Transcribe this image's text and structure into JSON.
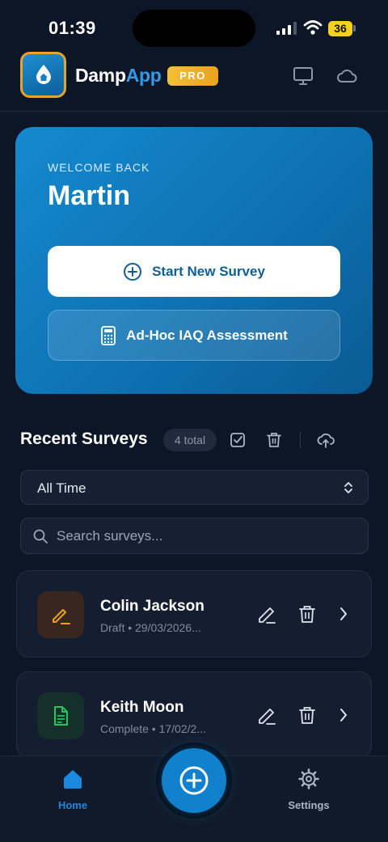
{
  "status_bar": {
    "time": "01:39",
    "battery": "36"
  },
  "header": {
    "brand_part1": "Damp",
    "brand_part2": "App",
    "badge": "PRO",
    "icons": [
      "desktop-icon",
      "cloud-icon"
    ]
  },
  "hero": {
    "greeting": "WELCOME BACK",
    "user_name": "Martin",
    "primary_button": "Start New Survey",
    "secondary_button": "Ad-Hoc IAQ Assessment"
  },
  "recent": {
    "title": "Recent Surveys",
    "count_label": "4 total",
    "tool_icons": [
      "select-all-icon",
      "trash-icon",
      "cloud-upload-icon"
    ],
    "filter": {
      "selected": "All Time"
    },
    "search": {
      "placeholder": "Search surveys..."
    },
    "items": [
      {
        "name": "Colin Jackson",
        "meta": "Draft • 29/03/2026...",
        "status_icon": "pencil-icon",
        "accent": "#e9a21f"
      },
      {
        "name": "Keith Moon",
        "meta": "Complete • 17/02/2...",
        "status_icon": "document-icon",
        "accent": "#22c55e"
      }
    ]
  },
  "bottom_nav": {
    "home_label": "Home",
    "settings_label": "Settings"
  },
  "colors": {
    "background": "#0d1627",
    "accent": "#1181cd",
    "brand_app": "#2f9bea",
    "pro_badge": "#f3c132"
  }
}
